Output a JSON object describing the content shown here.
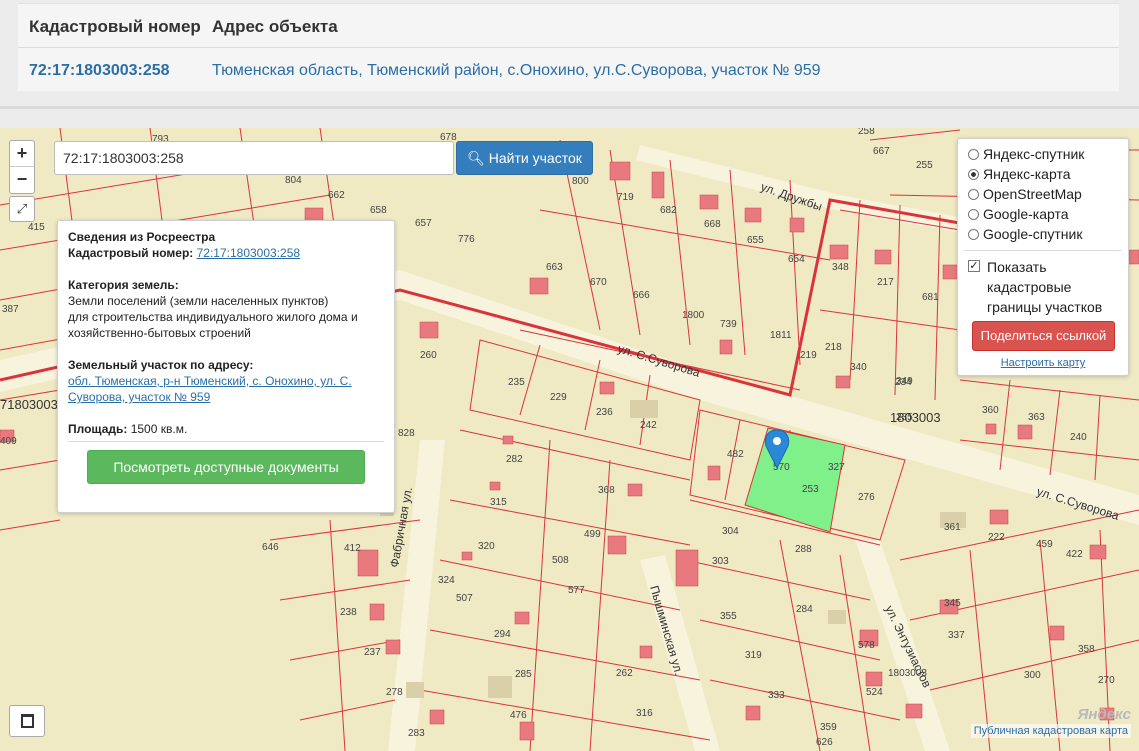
{
  "table": {
    "col_cadastral": "Кадастровый номер",
    "col_address": "Адрес объекта",
    "cadastral_number": "72:17:1803003:258",
    "address": "Тюменская область, Тюменский район, с.Онохино, ул.С.Суворова, участок № 959"
  },
  "controls": {
    "zoom_in": "+",
    "zoom_out": "−",
    "fullscreen": "⤢",
    "search_value": "72:17:1803003:258",
    "search_button": "Найти участок"
  },
  "popup": {
    "title": "Сведения из Росреестра",
    "cad_label": "Кадастровый номер:",
    "cad_value": "72:17:1803003:258",
    "category_label": "Категория земель:",
    "category_text": "Земли поселений (земли населенных пунктов)",
    "purpose_text": "для строительства индивидуального жилого дома и хозяйственно-бытовых строений",
    "address_label": "Земельный участок по адресу:",
    "address_link": "обл. Тюменская, р-н Тюменский, с. Онохино, ул. С. Суворова, участок № 959",
    "area_label": "Площадь:",
    "area_value": "1500 кв.м.",
    "docs_button": "Посмотреть доступные документы"
  },
  "layers": {
    "options": [
      "Яндекс-спутник",
      "Яндекс-карта",
      "OpenStreetMap",
      "Google-карта",
      "Google-спутник"
    ],
    "selected": "Яндекс-карта",
    "show_borders": "Показать кадастровые границы участков",
    "share_button": "Поделиться ссылкой",
    "configure_link": "Настроить карту"
  },
  "map": {
    "streets": [
      "ул. Дружбы",
      "ул. С.Суворова",
      "ул. С.Суворова",
      "Фабричная ул.",
      "Пышминская ул.",
      "ул. Энтузиастов"
    ],
    "quarter_labels": [
      "1803003",
      "71803003"
    ],
    "parcel_labels": [
      "793",
      "678",
      "415",
      "804",
      "662",
      "658",
      "657",
      "776",
      "387",
      "260",
      "409",
      "828",
      "235",
      "229",
      "236",
      "242",
      "282",
      "315",
      "368",
      "499",
      "320",
      "508",
      "412",
      "324",
      "507",
      "294",
      "577",
      "238",
      "237",
      "278",
      "285",
      "262",
      "316",
      "476",
      "283",
      "646",
      "800",
      "719",
      "682",
      "668",
      "655",
      "654",
      "663",
      "670",
      "666",
      "1800",
      "739",
      "1811",
      "219",
      "218",
      "340",
      "349",
      "348",
      "217",
      "681",
      "234",
      "667",
      "255",
      "258",
      "482",
      "570",
      "253",
      "327",
      "276",
      "304",
      "303",
      "288",
      "284",
      "355",
      "319",
      "333",
      "359",
      "360",
      "363",
      "240",
      "361",
      "222",
      "459",
      "422",
      "345",
      "337",
      "358",
      "300",
      "270",
      "524",
      "578",
      "1803003",
      "626",
      "235"
    ],
    "selected_parcel": "258",
    "copyright": "Публичная кадастровая карта",
    "yandex": "Яндекс"
  },
  "colors": {
    "map_bg": "#efe9c4",
    "parcel_border": "#d9343b",
    "selected_parcel": "#7ff08a",
    "marker": "#2b88d8",
    "building": "#e8797e"
  }
}
